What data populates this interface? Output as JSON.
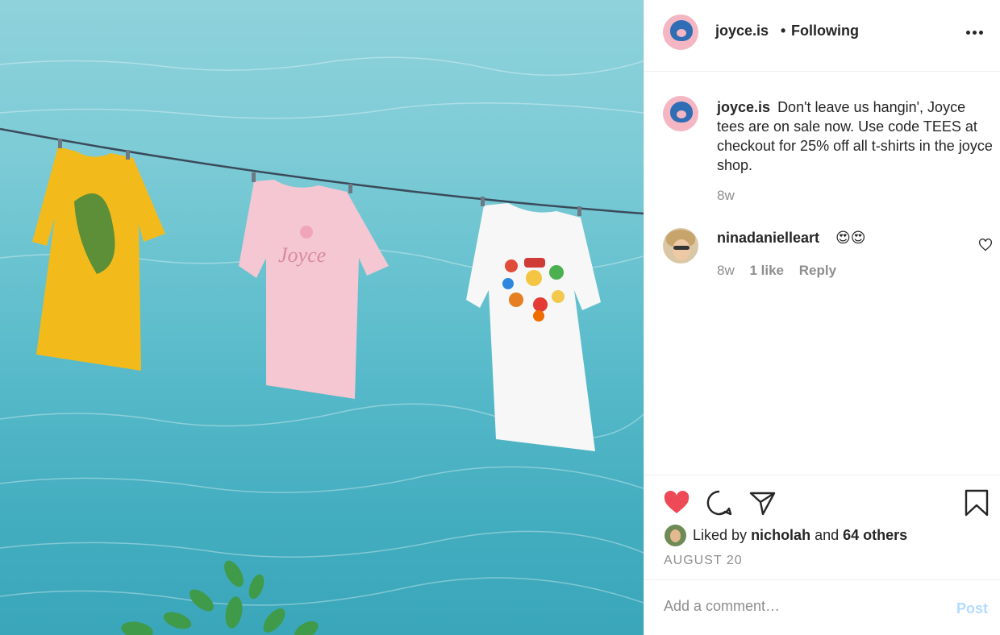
{
  "post": {
    "image_alt": "Three t-shirts hanging on a clothesline over water",
    "author": "joyce.is",
    "follow_separator": "•",
    "follow_status": "Following",
    "caption_text": "Don't leave us hangin', Joyce tees are on sale now. Use code TEES at checkout for 25% off all t-shirts in the joyce shop.",
    "caption_time": "8w"
  },
  "comments": [
    {
      "username": "ninadanielleart",
      "text": "😍😍",
      "time": "8w",
      "likes": "1 like",
      "reply": "Reply"
    }
  ],
  "actions": {
    "like_icon": "heart-filled-icon",
    "comment_icon": "comment-icon",
    "share_icon": "send-icon",
    "save_icon": "bookmark-icon",
    "liked_by_prefix": "Liked by",
    "liked_by_user": "nicholah",
    "liked_by_join": "and",
    "liked_by_others": "64 others",
    "date": "AUGUST 20"
  },
  "add_comment": {
    "placeholder": "Add a comment…",
    "post_label": "Post"
  },
  "colors": {
    "heart": "#ed4956",
    "post_disabled": "#b3dbff",
    "avatar_bg": "#f4b6c2",
    "avatar_blob": "#2f6db5"
  }
}
